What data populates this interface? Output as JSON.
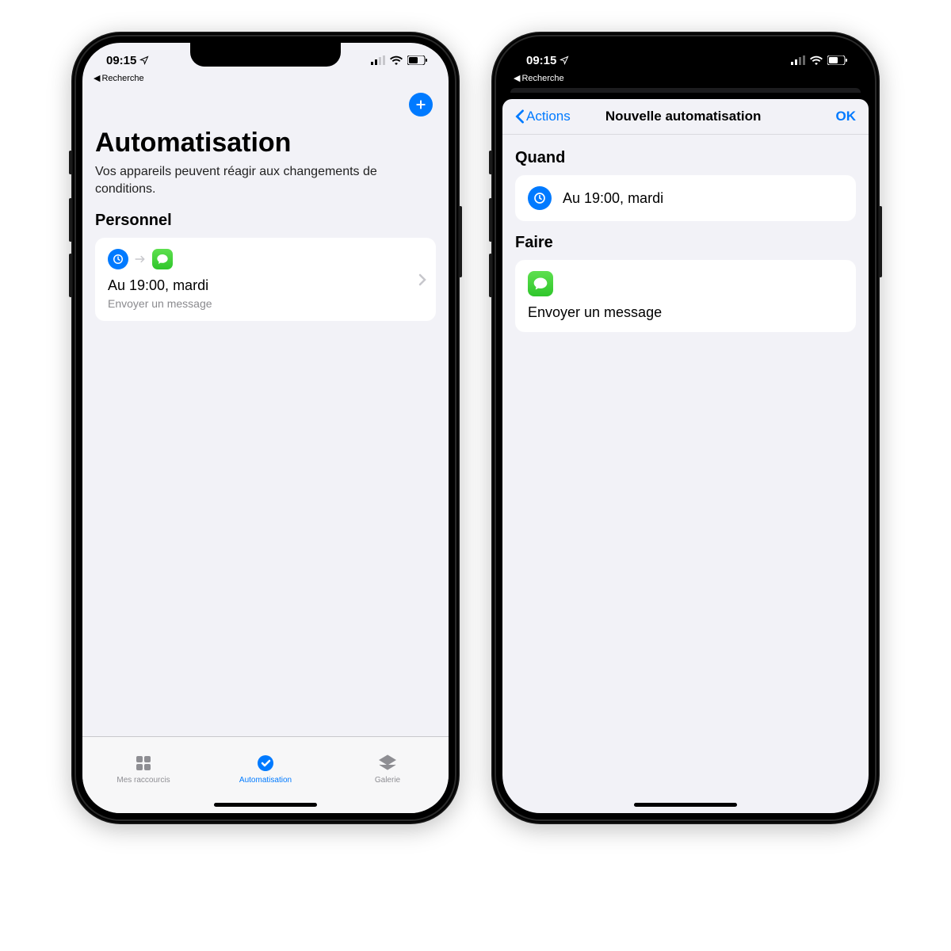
{
  "status": {
    "time": "09:15",
    "back_app": "Recherche"
  },
  "left": {
    "title": "Automatisation",
    "subtitle": "Vos appareils peuvent réagir aux changements de conditions.",
    "section": "Personnel",
    "automation": {
      "title": "Au 19:00, mardi",
      "subtitle": "Envoyer un message"
    },
    "tabs": {
      "shortcuts": "Mes raccourcis",
      "automation": "Automatisation",
      "gallery": "Galerie"
    }
  },
  "right": {
    "nav_back": "Actions",
    "nav_title": "Nouvelle automatisation",
    "nav_ok": "OK",
    "when_label": "Quand",
    "when_value": "Au 19:00, mardi",
    "do_label": "Faire",
    "do_value": "Envoyer un message"
  }
}
